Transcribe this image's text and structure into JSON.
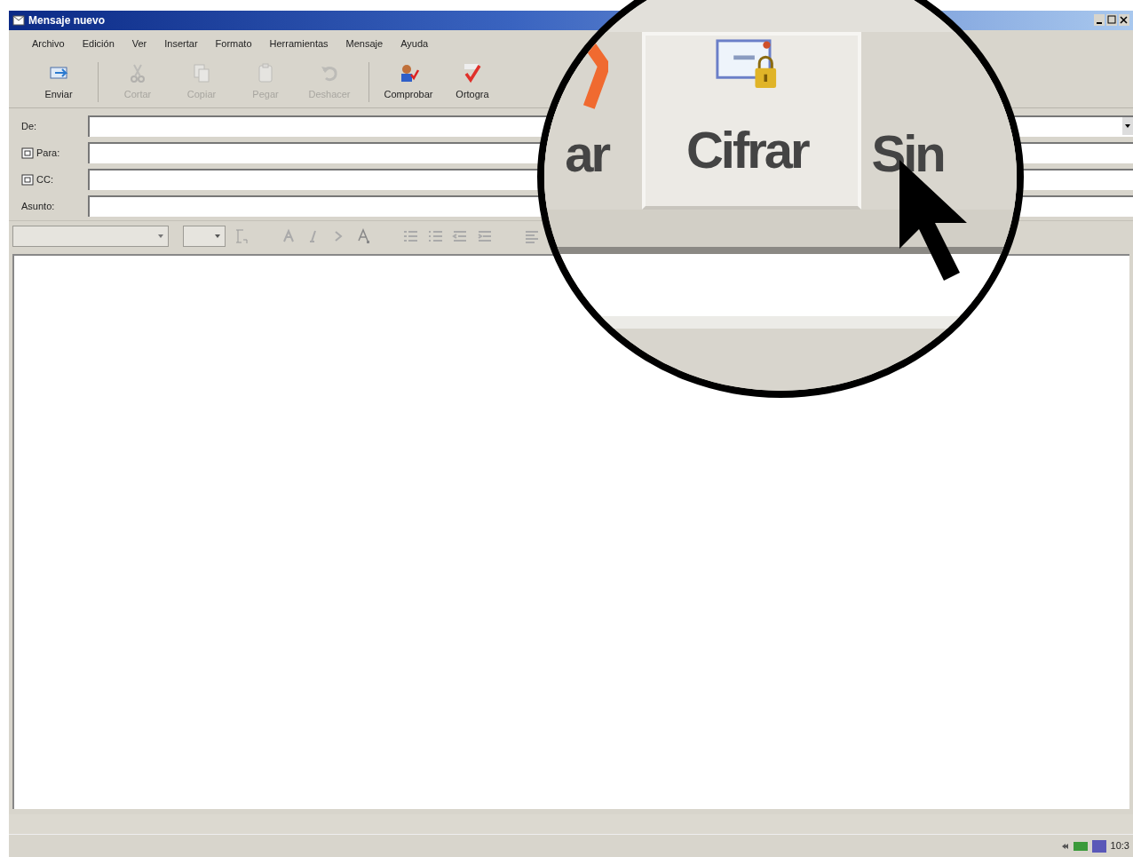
{
  "window": {
    "title": "Mensaje nuevo"
  },
  "menu": [
    "Archivo",
    "Edición",
    "Ver",
    "Insertar",
    "Formato",
    "Herramientas",
    "Mensaje",
    "Ayuda"
  ],
  "toolbar": [
    {
      "label": "Enviar",
      "kind": "send",
      "disabled": false
    },
    {
      "label": "Cortar",
      "kind": "cut",
      "disabled": true
    },
    {
      "label": "Copiar",
      "kind": "copy",
      "disabled": true
    },
    {
      "label": "Pegar",
      "kind": "paste",
      "disabled": true
    },
    {
      "label": "Deshacer",
      "kind": "undo",
      "disabled": true
    },
    {
      "label": "Comprobar",
      "kind": "check",
      "disabled": false
    },
    {
      "label": "Ortogra",
      "kind": "spelling",
      "disabled": false
    }
  ],
  "fields": [
    {
      "label": "De:",
      "kind": "dropdown"
    },
    {
      "label": "Para:",
      "kind": "address"
    },
    {
      "label": "CC:",
      "kind": "address"
    },
    {
      "label": "Asunto:",
      "kind": "plain"
    }
  ],
  "magnifier": {
    "buttons": [
      {
        "label": "ar",
        "kind": "spelling",
        "selected": false
      },
      {
        "label": "Cifrar",
        "kind": "encrypt",
        "selected": true
      },
      {
        "label": "Sin",
        "kind": "plain",
        "selected": false
      }
    ]
  },
  "tray": {
    "clock": "10:3"
  }
}
